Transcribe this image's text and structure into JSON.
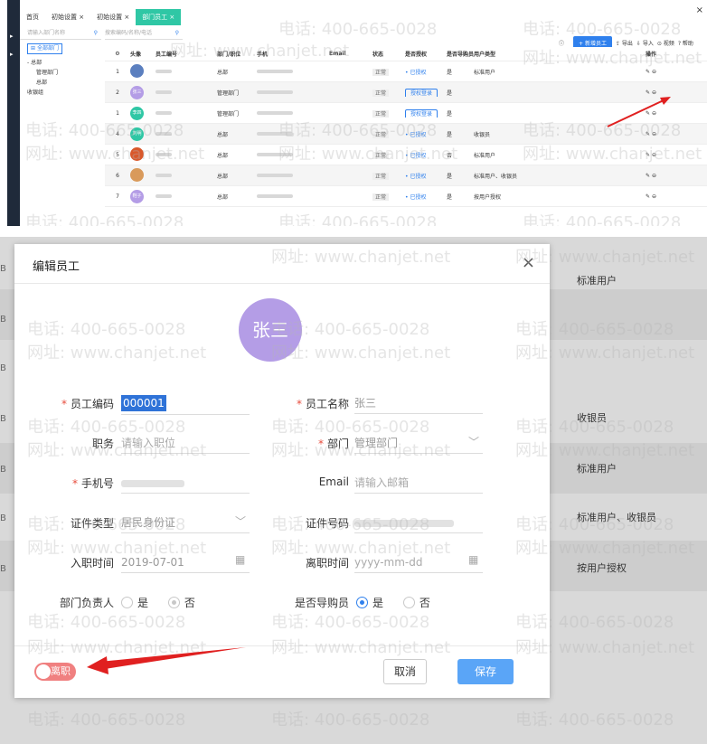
{
  "top": {
    "tabs": [
      "首页",
      "初始设置 ×",
      "初始设置 ×",
      "部门员工 ×"
    ],
    "tree": {
      "search_placeholder": "请输入部门名称",
      "all_label": "全部部门",
      "nodes": [
        "- 总部",
        "管理部门",
        "总部",
        "收银组"
      ]
    },
    "search_placeholder": "搜索编码/名称/电话",
    "toolbar": {
      "new_employee": "+ 新增员工",
      "export": "导出",
      "import": "导入",
      "video": "视频",
      "help": "帮助"
    },
    "columns": [
      "头像",
      "员工编号",
      "部门/职位",
      "手机",
      "Email",
      "状态",
      "是否授权",
      "是否导购员",
      "用户类型",
      "操作"
    ],
    "rows": [
      {
        "idx": "1",
        "av_color": "#5b7fbf",
        "av_text": "",
        "dept": "总部",
        "status": "正常",
        "auth": "已授权",
        "guide": "是",
        "type": "标准用户",
        "alt": false
      },
      {
        "idx": "2",
        "av_color": "#b49de6",
        "av_text": "张三",
        "dept": "管理部门",
        "status": "正常",
        "auth": "授权登录",
        "guide": "是",
        "type": "",
        "alt": true
      },
      {
        "idx": "1",
        "av_color": "#2fc7a5",
        "av_text": "李四",
        "dept": "管理部门",
        "status": "正常",
        "auth": "授权登录",
        "guide": "是",
        "type": "",
        "alt": false
      },
      {
        "idx": "4",
        "av_color": "#2fc7a5",
        "av_text": "刘明",
        "dept": "总部",
        "status": "正常",
        "auth": "已授权",
        "guide": "是",
        "type": "收银员",
        "alt": true
      },
      {
        "idx": "5",
        "av_color": "#d9582b",
        "av_text": "",
        "dept": "总部",
        "status": "正常",
        "auth": "已授权",
        "guide": "否",
        "type": "标准用户",
        "alt": false
      },
      {
        "idx": "6",
        "av_color": "#d99a5b",
        "av_text": "",
        "dept": "总部",
        "status": "正常",
        "auth": "已授权",
        "guide": "是",
        "type": "标准用户、收银员",
        "alt": true
      },
      {
        "idx": "7",
        "av_color": "#b49de6",
        "av_text": "鞋子",
        "dept": "总部",
        "status": "正常",
        "auth": "已授权",
        "guide": "是",
        "type": "按用户授权",
        "alt": false
      }
    ]
  },
  "bottom": {
    "bg_cells": [
      "标准用户",
      "收银员",
      "标准用户",
      "标准用户、收银员",
      "按用户授权"
    ],
    "dialog": {
      "title": "编辑员工",
      "close": "×",
      "avatar_text": "张三",
      "fields": {
        "code_label": "员工编码",
        "code_value": "000001",
        "name_label": "员工名称",
        "name_value": "张三",
        "position_label": "职务",
        "position_placeholder": "请输入职位",
        "dept_label": "部门",
        "dept_value": "管理部门",
        "phone_label": "手机号",
        "email_label": "Email",
        "email_placeholder": "请输入邮箱",
        "idtype_label": "证件类型",
        "idtype_value": "居民身份证",
        "idno_label": "证件号码",
        "hire_label": "入职时间",
        "hire_value": "2019-07-01",
        "leave_label": "离职时间",
        "leave_placeholder": "yyyy-mm-dd",
        "head_label": "部门负责人",
        "yes": "是",
        "no": "否",
        "guide_label": "是否导购员"
      },
      "footer": {
        "toggle_label": "离职",
        "cancel": "取消",
        "save": "保存"
      }
    },
    "watermarks": [
      "电话: 400-665-0028",
      "网址: www.chanjet.net"
    ]
  },
  "colors": {
    "accent": "#2f80ed",
    "tab_active": "#2fc7a5",
    "avatar": "#b49de6",
    "required": "#e74c3c",
    "toggle": "#f08080",
    "arrow": "#e02020"
  }
}
